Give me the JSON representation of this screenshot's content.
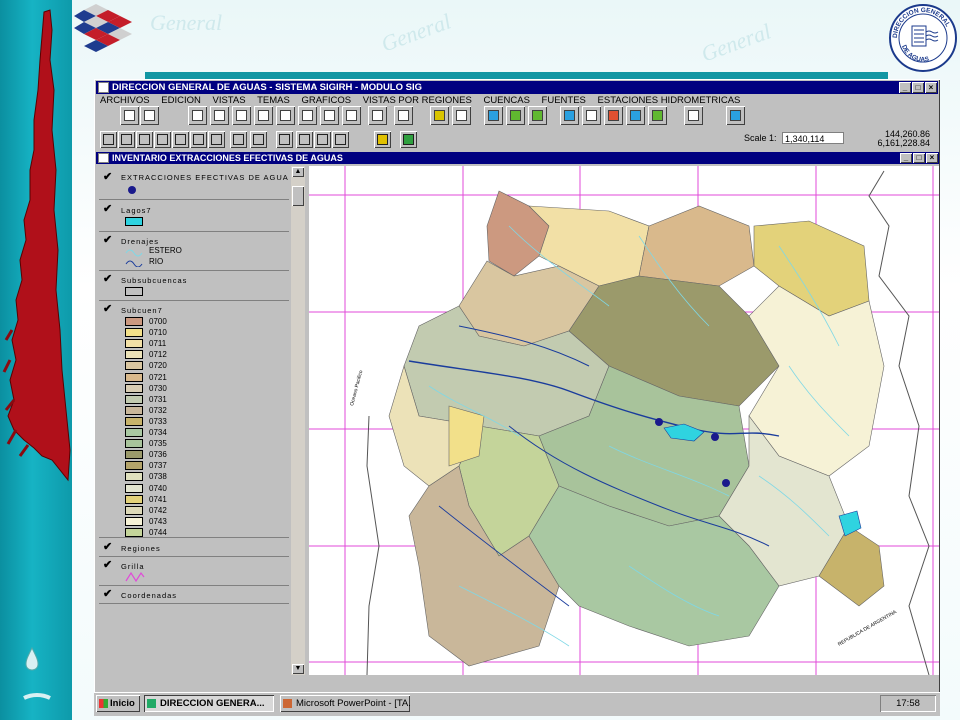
{
  "slide": {
    "accent": "#1296a3",
    "watermark_word": "General",
    "logo_right_text_top": "DIRECCION GENERAL",
    "logo_right_text_bottom": "DE AGUAS"
  },
  "app": {
    "title": "DIRECCION GENERAL DE AGUAS - SISTEMA SIGIRH - MODULO SIG",
    "menu": [
      "ARCHIVOS",
      "EDICION",
      "VISTAS",
      "TEMAS",
      "GRAFICOS",
      "VISTAS POR REGIONES",
      "CUENCAS",
      "FUENTES",
      "ESTACIONES HIDROMETRICAS"
    ],
    "scale_label": "Scale 1:",
    "scale_value": "1,340,114",
    "coord_x": "144,260.86",
    "coord_y": "6,161,228.84"
  },
  "view": {
    "title": "INVENTARIO EXTRACCIONES EFECTIVAS DE AGUAS",
    "legend": {
      "extracciones": "EXTRACCIONES EFECTIVAS DE AGUA",
      "lagos": "Lagos7",
      "drenajes": "Drenajes",
      "estero": "ESTERO",
      "rio": "RIO",
      "subsubcuencas": "Subsubcuencas",
      "subcuen": "Subcuen7",
      "classes": [
        "0700",
        "0710",
        "0711",
        "0712",
        "0720",
        "0721",
        "0730",
        "0731",
        "0732",
        "0733",
        "0734",
        "0735",
        "0736",
        "0737",
        "0738",
        "0740",
        "0741",
        "0742",
        "0743",
        "0744"
      ],
      "class_colors": [
        "#cc9980",
        "#f2e08a",
        "#f2e0a6",
        "#ece2b8",
        "#d9c6a0",
        "#d9b98c",
        "#d9cdb3",
        "#c2cbb0",
        "#c9b79a",
        "#c7b36b",
        "#a9c8a2",
        "#a8c39b",
        "#9b9a6b",
        "#b4a46a",
        "#dfe0bd",
        "#e3e5d0",
        "#e3d27a",
        "#ddd9b8",
        "#f6f2d6",
        "#c4d49a"
      ],
      "regiones": "Regiones",
      "grilla": "Grilla",
      "coordenadas": "Coordenadas"
    },
    "map_labels": {
      "ocean": "Oceano Pacifico",
      "border": "REPUBLICA DE ARGENTINA"
    }
  },
  "taskbar": {
    "start": "Inicio",
    "tasks": [
      "DIRECCION GENERA...",
      "Microsoft PowerPoint - [TA..."
    ],
    "clock": "17:58"
  }
}
